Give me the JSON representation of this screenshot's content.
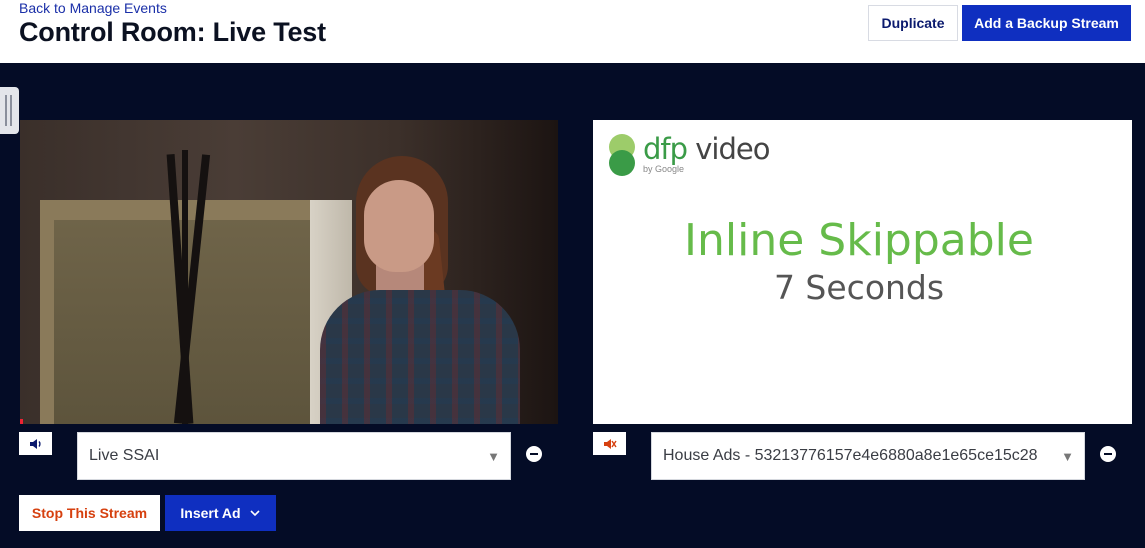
{
  "header": {
    "back_link": "Back to Manage Events",
    "title": "Control Room: Live Test",
    "duplicate_label": "Duplicate",
    "add_backup_label": "Add a Backup Stream"
  },
  "streams": [
    {
      "source_label": "Live SSAI",
      "audio": "on",
      "volume_icon": "speaker-icon"
    },
    {
      "source_label": "House Ads - 53213776157e4e6880a8e1e65ce15c28",
      "audio": "muted",
      "volume_icon": "speaker-muted-icon",
      "preview": {
        "logo_brand": "dfp",
        "logo_product": "video",
        "logo_sub": "by Google",
        "headline": "Inline Skippable",
        "subline": "7 Seconds"
      }
    }
  ],
  "actions": {
    "stop_label": "Stop This Stream",
    "insert_ad_label": "Insert Ad"
  },
  "colors": {
    "primary": "#0f2fc0",
    "dark_background": "#040c26",
    "danger_text": "#d6400f",
    "ad_green": "#66bb4a"
  }
}
